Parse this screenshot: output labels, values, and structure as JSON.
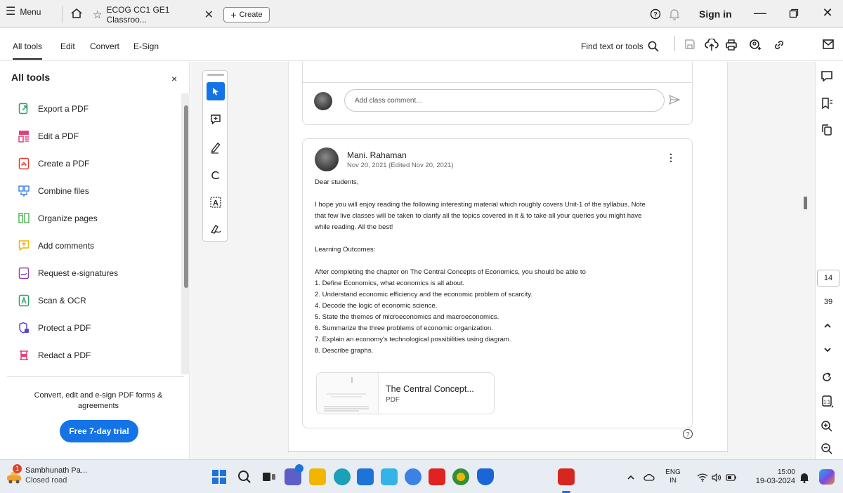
{
  "topbar": {
    "menu_label": "Menu",
    "tab_title": "ECOG CC1 GE1 Classroo...",
    "tab_close": "✕",
    "create_label": "Create",
    "sign_in": "Sign in"
  },
  "menubar": {
    "items": [
      "All tools",
      "Edit",
      "Convert",
      "E-Sign"
    ],
    "find_label": "Find text or tools"
  },
  "panel": {
    "title": "All tools",
    "close": "×",
    "tools": [
      {
        "label": "Export a PDF",
        "icon": "export-pdf-icon",
        "color": "#26a269"
      },
      {
        "label": "Edit a PDF",
        "icon": "edit-pdf-icon",
        "color": "#e0407a"
      },
      {
        "label": "Create a PDF",
        "icon": "create-pdf-icon",
        "color": "#e03c31"
      },
      {
        "label": "Combine files",
        "icon": "combine-files-icon",
        "color": "#3b7be0"
      },
      {
        "label": "Organize pages",
        "icon": "organize-pages-icon",
        "color": "#4caf50"
      },
      {
        "label": "Add comments",
        "icon": "add-comments-icon",
        "color": "#f0b400"
      },
      {
        "label": "Request e-signatures",
        "icon": "request-esign-icon",
        "color": "#8e44ad"
      },
      {
        "label": "Scan & OCR",
        "icon": "scan-ocr-icon",
        "color": "#26a269"
      },
      {
        "label": "Protect a PDF",
        "icon": "protect-pdf-icon",
        "color": "#5b4ac6"
      },
      {
        "label": "Redact a PDF",
        "icon": "redact-pdf-icon",
        "color": "#e0407a"
      }
    ],
    "promo": "Convert, edit and e-sign PDF forms & agreements",
    "trial_button": "Free 7-day trial"
  },
  "doc": {
    "comment_placeholder": "Add class comment...",
    "author": "Mani. Rahaman",
    "date": "Nov 20, 2021 (Edited Nov 20, 2021)",
    "greeting": "Dear students,",
    "para1_line1": "I hope you will enjoy reading the following interesting material which roughly covers Unit-1 of the syllabus. Note",
    "para1_line2": "that few live classes will be taken to clarify all the topics covered in it & to take all your queries you might have",
    "para1_line3": "while reading. All the best!",
    "outcomes_heading": "Learning Outcomes:",
    "outcomes_intro": "After completing the chapter on The Central Concepts of Economics, you should be able to",
    "outcomes": [
      "1. Define Economics, what economics is all about.",
      "2. Understand economic efficiency and the economic problem of scarcity.",
      "4. Decode the logic of economic science.",
      "5. State the themes of microeconomics and macroeconomics.",
      "6. Summarize the three problems of economic organization.",
      "7. Explain an economy's technological possibilities using diagram.",
      "8. Describe graphs."
    ],
    "attachment_title": "The Central Concept...",
    "attachment_type": "PDF"
  },
  "rightbar": {
    "page_current": "14",
    "page_total": "39"
  },
  "taskbar": {
    "news_title": "Sambhunath Pa...",
    "news_sub": "Closed road",
    "news_badge": "1",
    "lang_top": "ENG",
    "lang_bottom": "IN",
    "time": "15:00",
    "date": "19-03-2024"
  }
}
